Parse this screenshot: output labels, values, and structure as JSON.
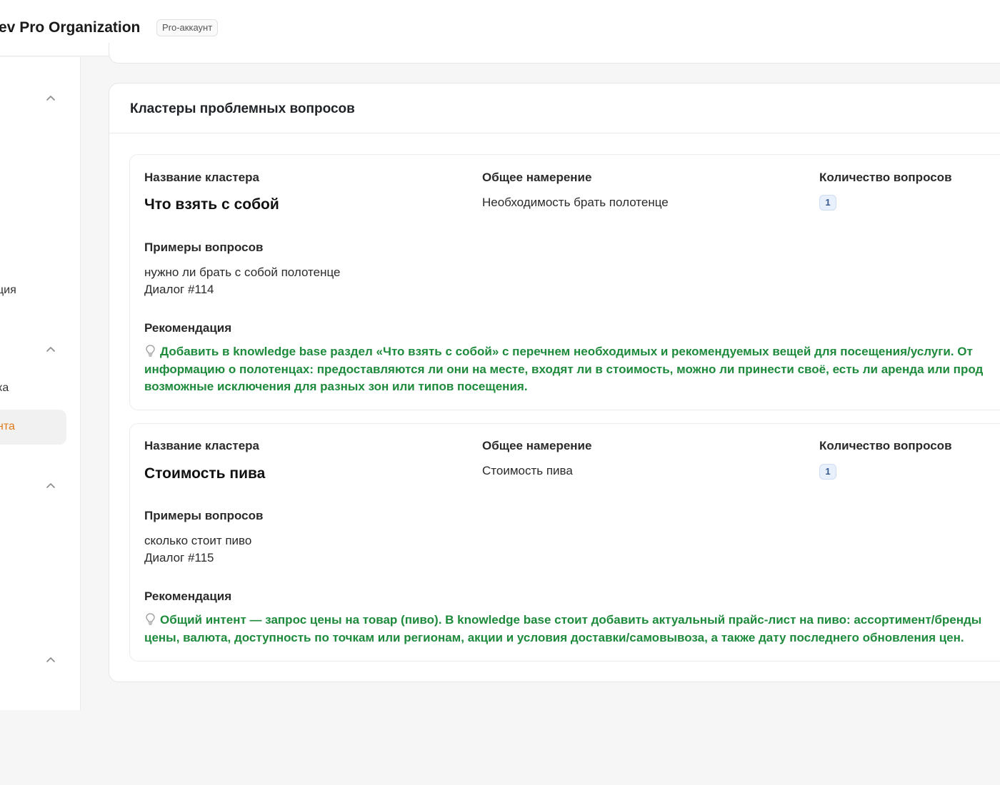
{
  "header": {
    "org_title": "ev Pro Organization",
    "plan_badge": "Pro-аккаунт"
  },
  "sidebar": {
    "chevrons": [
      "chevron-up-icon",
      "chevron-up-icon",
      "chevron-up-icon",
      "chevron-up-icon"
    ],
    "partial_items": [
      "ция",
      "ка"
    ],
    "active_item": "нта",
    "active_color": "#e07b1a"
  },
  "clusters_panel": {
    "title": "Кластеры проблемных вопросов",
    "labels": {
      "cluster_name": "Название кластера",
      "common_intent": "Общее намерение",
      "question_count": "Количество вопросов",
      "examples": "Примеры вопросов",
      "recommendation": "Рекомендация"
    },
    "clusters": [
      {
        "name": "Что взять с собой",
        "intent": "Необходимость брать полотенце",
        "count": "1",
        "example_question": "нужно ли брать с собой полотенце",
        "example_dialog": "Диалог #114",
        "recommendation_lines": [
          "Добавить в knowledge base раздел «Что взять с собой» с перечнем необходимых и рекомендуемых вещей для посещения/услуги. От",
          "информацию о полотенцах: предоставляются ли они на месте, входят ли в стоимость, можно ли принести своё, есть ли аренда или прод",
          "возможные исключения для разных зон или типов посещения."
        ]
      },
      {
        "name": "Стоимость пива",
        "intent": "Стоимость пива",
        "count": "1",
        "example_question": "сколько стоит пиво",
        "example_dialog": "Диалог #115",
        "recommendation_lines": [
          "Общий интент — запрос цены на товар (пиво). В knowledge base стоит добавить актуальный прайс-лист на пиво: ассортимент/бренды",
          "цены, валюта, доступность по точкам или регионам, акции и условия доставки/самовывоза, а также дату последнего обновления цен."
        ]
      }
    ]
  },
  "colors": {
    "recommendation_text": "#1e8a3c",
    "count_badge_bg": "#e8f0fb"
  }
}
